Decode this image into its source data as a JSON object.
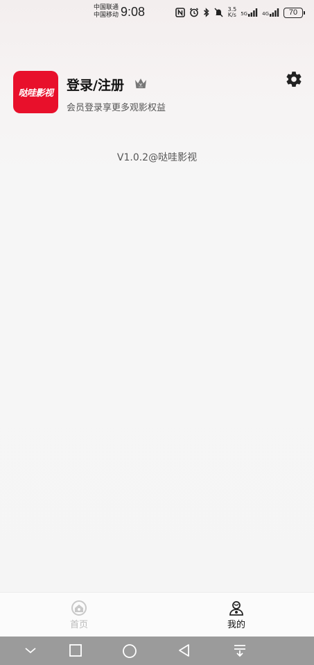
{
  "status_bar": {
    "carrier_1": "中国联通",
    "carrier_2": "中国移动",
    "time": "9:08",
    "speed_value": "3.5",
    "speed_unit": "K/s",
    "network_1": "5G",
    "network_2": "4G",
    "battery": "70"
  },
  "profile": {
    "avatar_text": "哒哇影视",
    "login_title": "登录/注册",
    "login_subtitle": "会员登录享更多观影权益"
  },
  "version": "V1.0.2@哒哇影视",
  "tabs": [
    {
      "label": "首页",
      "icon": "home-icon",
      "active": false
    },
    {
      "label": "我的",
      "icon": "profile-icon",
      "active": true
    }
  ],
  "colors": {
    "brand_red": "#e8102b",
    "nav_bar": "#9b9b9b"
  }
}
